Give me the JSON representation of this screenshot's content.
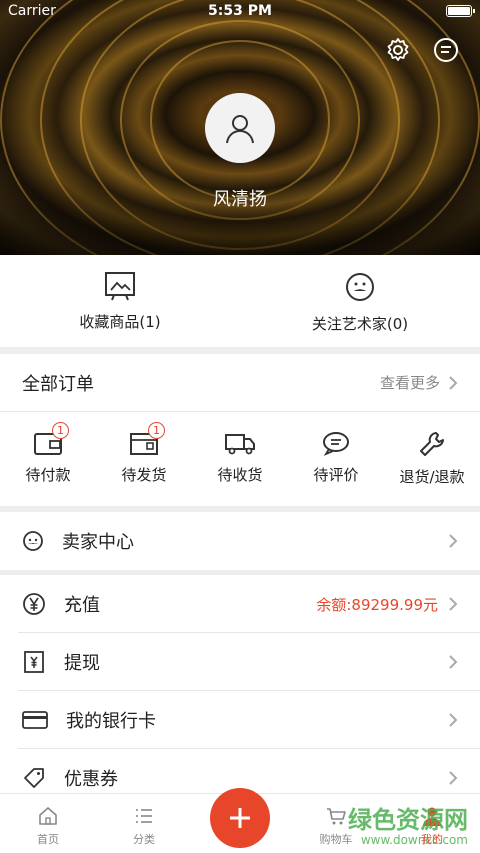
{
  "status": {
    "carrier": "Carrier",
    "time": "5:53 PM"
  },
  "profile": {
    "name": "风清扬"
  },
  "favorites": [
    {
      "label": "收藏商品(1)",
      "icon": "collection-frame-icon"
    },
    {
      "label": "关注艺术家(0)",
      "icon": "artist-icon"
    }
  ],
  "orders": {
    "title": "全部订单",
    "more": "查看更多",
    "items": [
      {
        "label": "待付款",
        "badge": "1",
        "icon": "wallet-icon"
      },
      {
        "label": "待发货",
        "badge": "1",
        "icon": "package-icon"
      },
      {
        "label": "待收货",
        "badge": "",
        "icon": "truck-icon"
      },
      {
        "label": "待评价",
        "badge": "",
        "icon": "comment-icon"
      },
      {
        "label": "退货/退款",
        "badge": "",
        "icon": "wrench-icon"
      }
    ]
  },
  "seller": {
    "label": "卖家中心"
  },
  "account": [
    {
      "label": "充值",
      "value": "余额:89299.99元",
      "icon": "yen-icon"
    },
    {
      "label": "提现",
      "value": "",
      "icon": "withdraw-icon"
    },
    {
      "label": "我的银行卡",
      "value": "",
      "icon": "bank-card-icon"
    },
    {
      "label": "优惠券",
      "value": "",
      "icon": "coupon-icon"
    }
  ],
  "tabs": [
    {
      "label": "首页",
      "icon": "home-icon"
    },
    {
      "label": "分类",
      "icon": "list-icon"
    },
    {
      "label": "购物车",
      "icon": "cart-icon"
    },
    {
      "label": "我的",
      "icon": "profile-icon"
    }
  ],
  "watermark": {
    "line1": "绿色资源网",
    "line2": "www.downcc.com"
  },
  "colors": {
    "accent": "#e8462a",
    "text": "#222222",
    "muted": "#888888"
  }
}
